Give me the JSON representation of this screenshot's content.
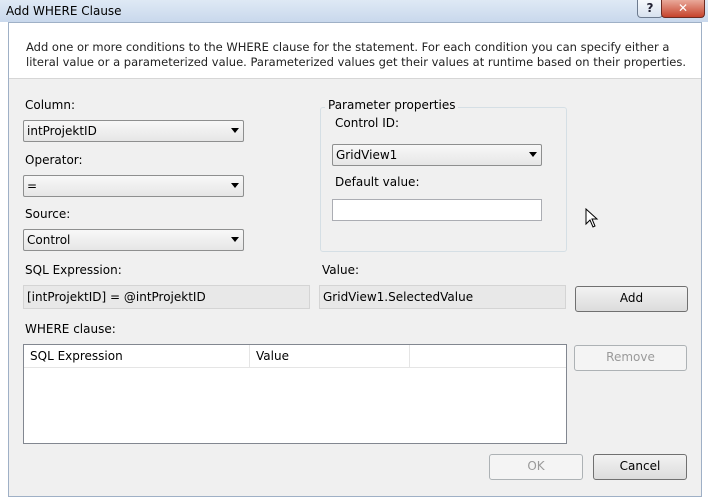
{
  "window": {
    "title": "Add WHERE Clause",
    "help_label": "?",
    "close_label": "✕"
  },
  "description": "Add one or more conditions to the WHERE clause for the statement. For each condition you can specify either a literal value or a parameterized value. Parameterized values get their values at runtime based on their properties.",
  "column": {
    "label": "Column:",
    "value": "intProjektID"
  },
  "operator": {
    "label": "Operator:",
    "value": "="
  },
  "source": {
    "label": "Source:",
    "value": "Control"
  },
  "parameter_properties": {
    "title": "Parameter properties",
    "control_id_label": "Control ID:",
    "control_id_value": "GridView1",
    "default_value_label": "Default value:",
    "default_value": ""
  },
  "sql_expression": {
    "label": "SQL Expression:",
    "value": "[intProjektID] = @intProjektID"
  },
  "value": {
    "label": "Value:",
    "value": "GridView1.SelectedValue"
  },
  "buttons": {
    "add": "Add",
    "remove": "Remove",
    "ok": "OK",
    "cancel": "Cancel"
  },
  "where_clause": {
    "label": "WHERE clause:",
    "columns": [
      "SQL Expression",
      "Value"
    ],
    "rows": []
  }
}
